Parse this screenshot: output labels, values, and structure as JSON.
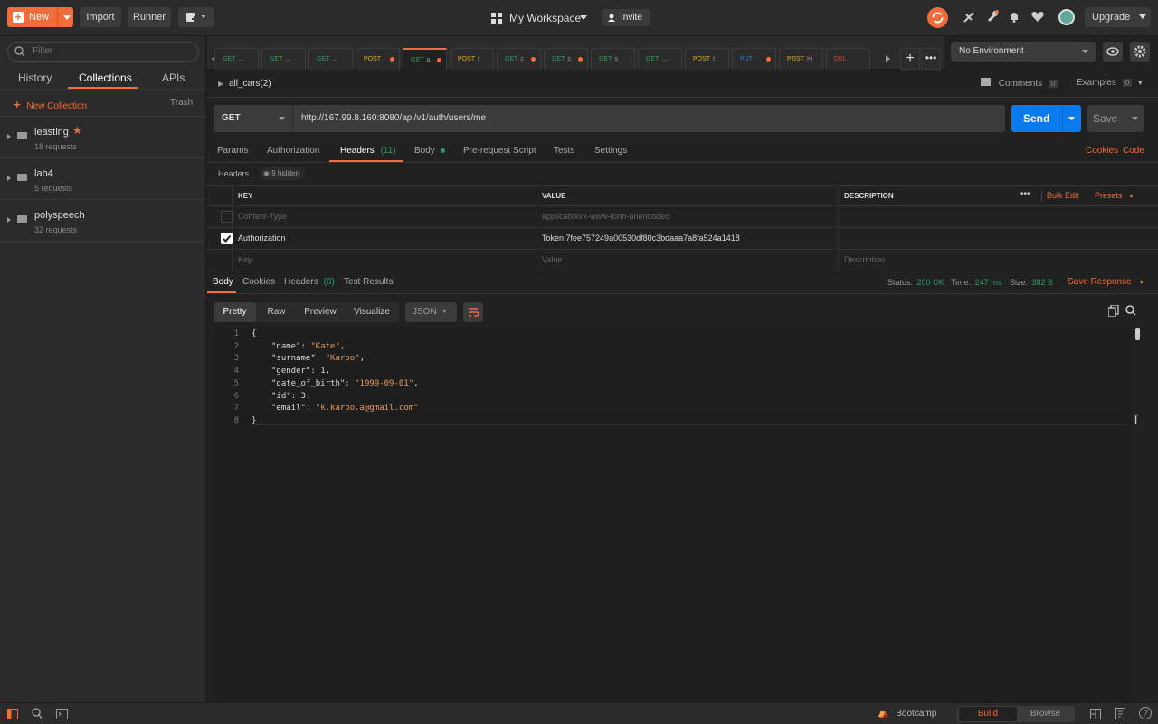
{
  "topbar": {
    "new_label": "New",
    "import_label": "Import",
    "runner_label": "Runner",
    "workspace_label": "My Workspace",
    "invite_label": "Invite",
    "upgrade_label": "Upgrade"
  },
  "sidebar": {
    "filter_placeholder": "Filter",
    "tabs": [
      "History",
      "Collections",
      "APIs"
    ],
    "active_tab": "Collections",
    "new_collection_label": "New Collection",
    "trash_label": "Trash",
    "collections": [
      {
        "name": "leasting",
        "requests": "18 requests",
        "starred": true
      },
      {
        "name": "lab4",
        "requests": "5 requests",
        "starred": false
      },
      {
        "name": "polyspeech",
        "requests": "32 requests",
        "starred": false
      }
    ]
  },
  "request_tabs": [
    {
      "method": "GET",
      "name": "...",
      "dot": false
    },
    {
      "method": "GET",
      "name": "...",
      "dot": false
    },
    {
      "method": "GET",
      "name": "...",
      "dot": false
    },
    {
      "method": "POST",
      "name": "",
      "dot": true
    },
    {
      "method": "GET",
      "name": "a",
      "dot": true,
      "active": true
    },
    {
      "method": "POST",
      "name": "t",
      "dot": false
    },
    {
      "method": "GET",
      "name": "c",
      "dot": true
    },
    {
      "method": "GET",
      "name": "s",
      "dot": true
    },
    {
      "method": "GET",
      "name": "s",
      "dot": false
    },
    {
      "method": "GET",
      "name": "...",
      "dot": false
    },
    {
      "method": "POST",
      "name": "t",
      "dot": false
    },
    {
      "method": "PUT",
      "name": "",
      "dot": true
    },
    {
      "method": "POST",
      "name": "H",
      "dot": false
    },
    {
      "method": "DEL",
      "name": "",
      "dot": false
    }
  ],
  "environment": {
    "selected": "No Environment"
  },
  "request": {
    "breadcrumb": "all_cars(2)",
    "comments_label": "Comments",
    "comments_count": "0",
    "examples_label": "Examples",
    "examples_count": "0",
    "method": "GET",
    "url": "http://167.99.8.160:8080/api/v1/auth/users/me",
    "send_label": "Send",
    "save_label": "Save",
    "tabs": {
      "params": "Params",
      "authorization": "Authorization",
      "headers": "Headers",
      "headers_count": "(11)",
      "body": "Body",
      "prerequest": "Pre-request Script",
      "tests": "Tests",
      "settings": "Settings",
      "cookies": "Cookies",
      "code": "Code"
    },
    "headers_label": "Headers",
    "hidden_label": "9 hidden",
    "table": {
      "col_key": "KEY",
      "col_value": "VALUE",
      "col_description": "DESCRIPTION",
      "bulk_edit": "Bulk Edit",
      "presets": "Presets",
      "rows": [
        {
          "key": "Content-Type",
          "value": "application/x-www-form-urlencoded",
          "description": "",
          "checked": false
        },
        {
          "key": "Authorization",
          "value": "Token 7fee757249a00530df80c3bdaaa7a8fa524a1418",
          "description": "",
          "checked": true
        },
        {
          "key": "Key",
          "value": "Value",
          "description": "Description",
          "checked": false
        }
      ]
    }
  },
  "response": {
    "tabs": {
      "body": "Body",
      "cookies": "Cookies",
      "headers": "Headers",
      "headers_count": "(8)",
      "test_results": "Test Results"
    },
    "status_label": "Status:",
    "status_value": "200 OK",
    "time_label": "Time:",
    "time_value": "247 ms",
    "size_label": "Size:",
    "size_value": "382 B",
    "save_response_label": "Save Response",
    "formats": [
      "Pretty",
      "Raw",
      "Preview",
      "Visualize"
    ],
    "active_format": "Pretty",
    "language": "JSON",
    "code_lines": [
      {
        "n": "1",
        "text": "{"
      },
      {
        "n": "2",
        "key": "\"name\"",
        "val": "\"Kate\"",
        "str": true,
        "comma": true
      },
      {
        "n": "3",
        "key": "\"surname\"",
        "val": "\"Karpo\"",
        "str": true,
        "comma": true
      },
      {
        "n": "4",
        "key": "\"gender\"",
        "val": "1",
        "str": false,
        "comma": true
      },
      {
        "n": "5",
        "key": "\"date_of_birth\"",
        "val": "\"1999-09-01\"",
        "str": true,
        "comma": true
      },
      {
        "n": "6",
        "key": "\"id\"",
        "val": "3",
        "str": false,
        "comma": true
      },
      {
        "n": "7",
        "key": "\"email\"",
        "val": "\"k.karpo.a@gmail.com\"",
        "str": true,
        "comma": false
      },
      {
        "n": "8",
        "text": "}"
      }
    ]
  },
  "bottombar": {
    "bootcamp_label": "Bootcamp",
    "build_label": "Build",
    "browse_label": "Browse"
  },
  "colors": {
    "accent": "#f26b3a",
    "send": "#097bed",
    "status_ok": "#2f9e5b",
    "get": "#2f9e5b",
    "post": "#e6a817",
    "put": "#2a7ad8",
    "del": "#e0413a"
  }
}
